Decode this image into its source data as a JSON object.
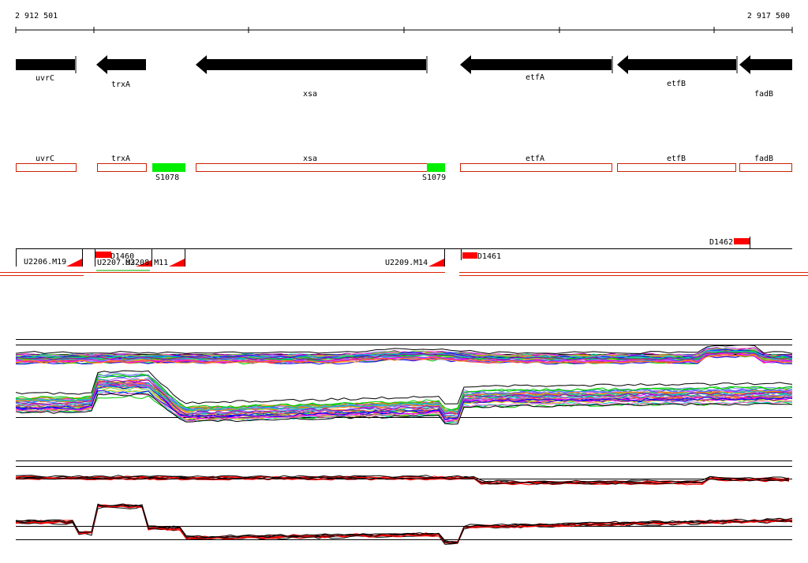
{
  "coords": {
    "start": "2 912 501",
    "end": "2 917 500"
  },
  "genes": [
    {
      "name": "uvrC",
      "strand": "+"
    },
    {
      "name": "trxA",
      "strand": "-"
    },
    {
      "name": "xsa",
      "strand": "-"
    },
    {
      "name": "etfA",
      "strand": "-"
    },
    {
      "name": "etfB",
      "strand": "-"
    },
    {
      "name": "fadB",
      "strand": "-"
    }
  ],
  "annotation_genes": [
    "uvrC",
    "trxA",
    "xsa",
    "etfA",
    "etfB",
    "fadB"
  ],
  "sites": [
    "S1078",
    "S1079"
  ],
  "features": [
    "D1460",
    "D1461",
    "D1462"
  ],
  "probes": [
    "U2206.M19",
    "U2207.M3",
    "U2208.M11",
    "U2209.M14"
  ],
  "colors": {
    "gene_box": "#000000",
    "annotation_outline": "#cc2200",
    "site": "#00ee00",
    "feature": "#ff0000",
    "track_line": "#000000"
  },
  "tracks": [
    "multi-colored expression profiles",
    "black/red expression profiles"
  ]
}
